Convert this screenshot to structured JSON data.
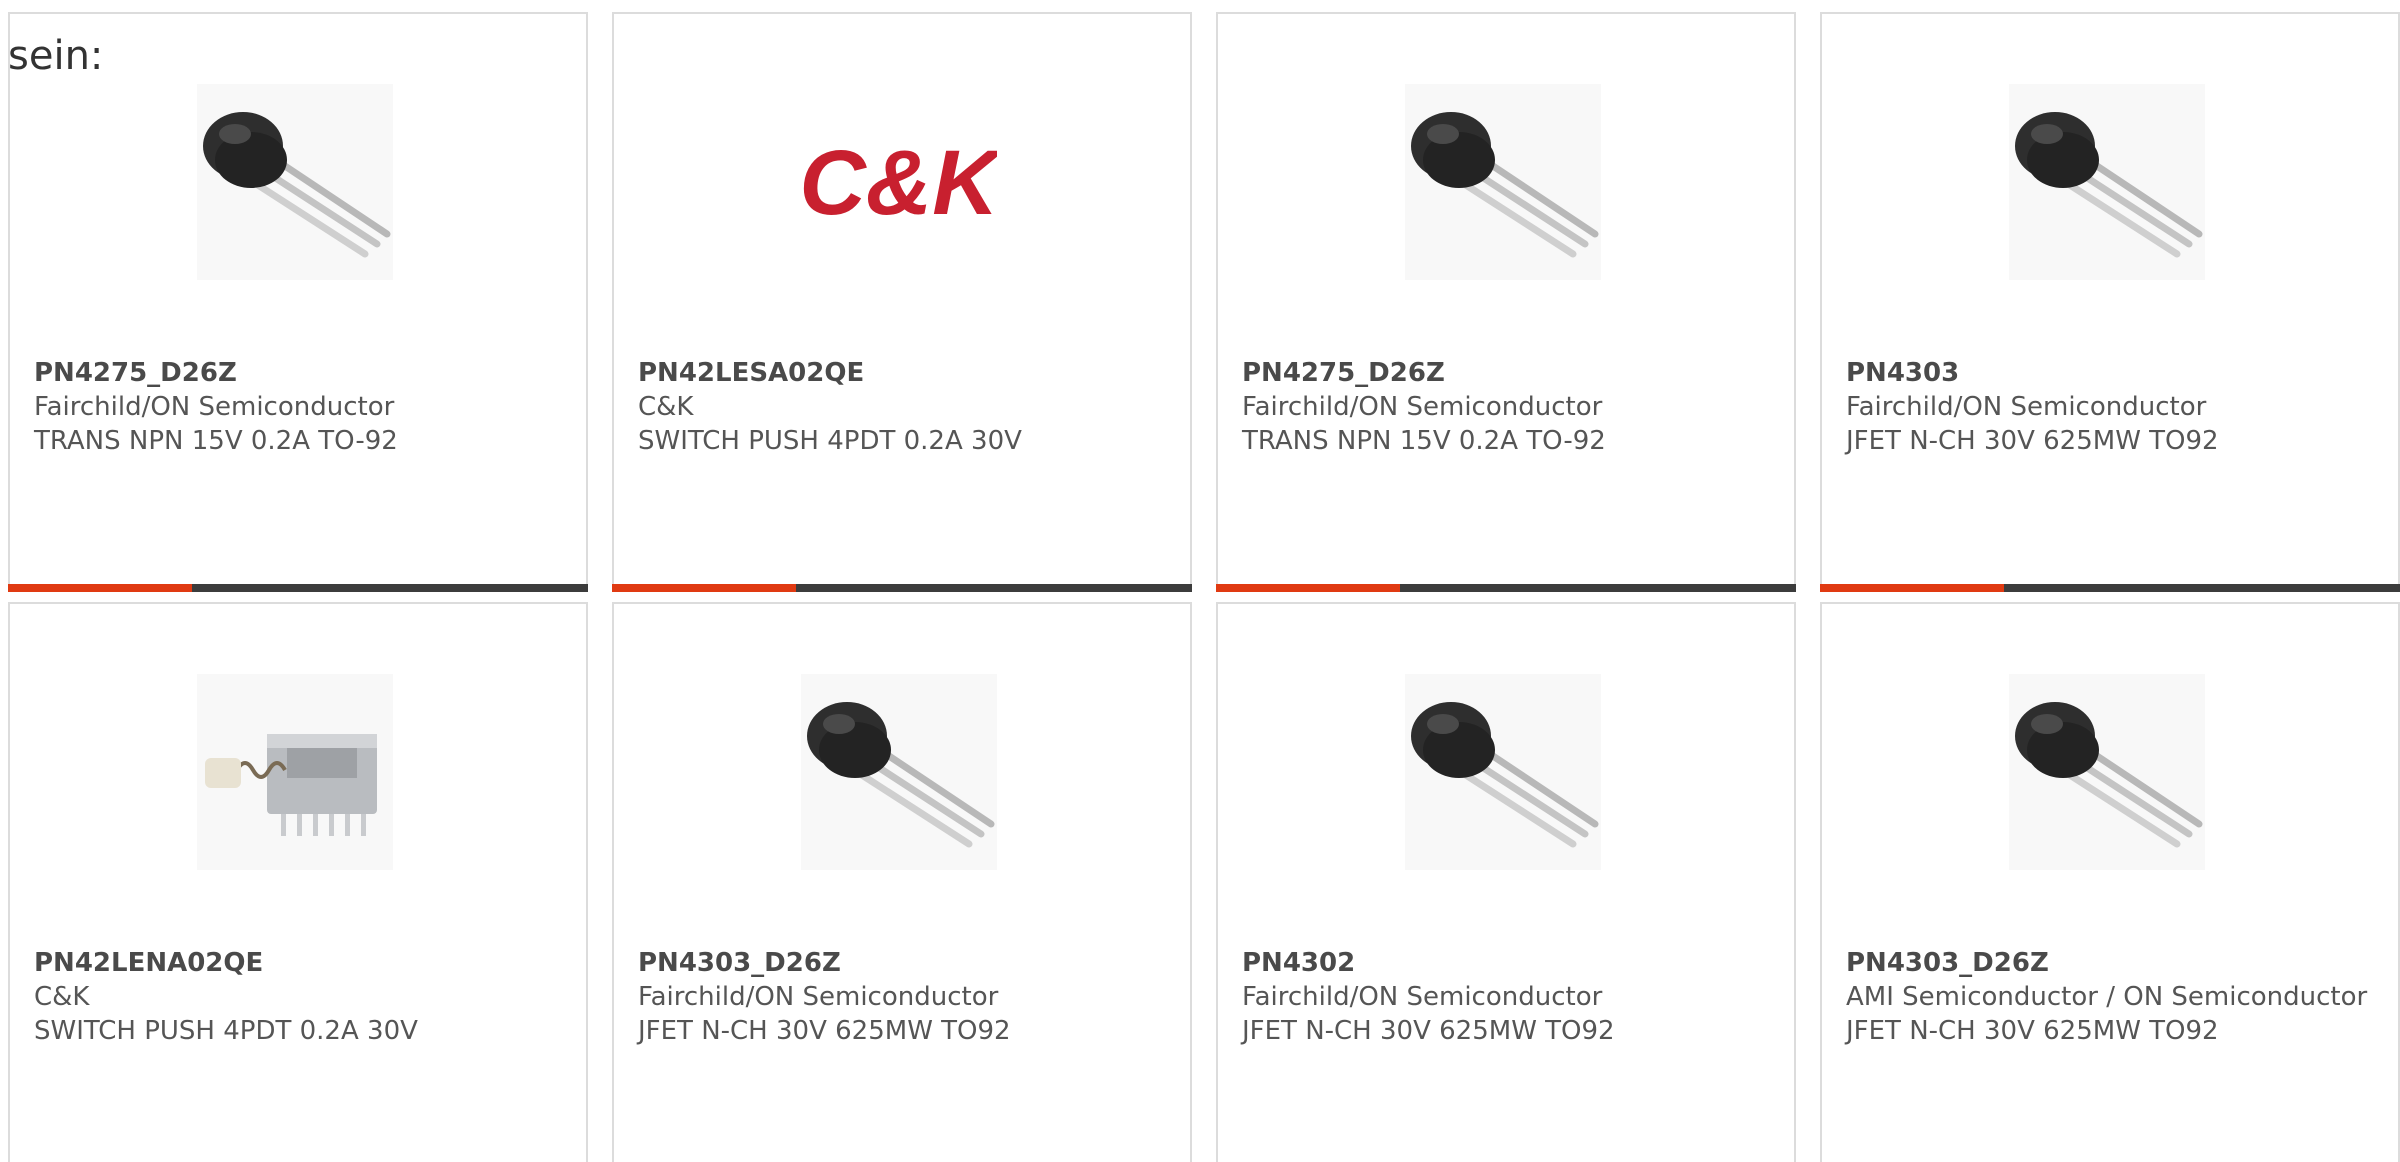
{
  "intro_text": "sein:",
  "colors": {
    "accent": "#e03a12",
    "bar_dark": "#3c3c3c",
    "card_border": "#dcdcdc",
    "text": "#555555",
    "ck_logo_red": "#c8202f"
  },
  "products": [
    {
      "part": "PN4275_D26Z",
      "manufacturer": "Fairchild/ON Semiconductor",
      "description": "TRANS NPN 15V 0.2A TO-92",
      "image": "transistor-to92-icon"
    },
    {
      "part": "PN42LESA02QE",
      "manufacturer": "C&K",
      "description": "SWITCH PUSH 4PDT 0.2A 30V",
      "image": "ck-logo",
      "image_text": "C&K"
    },
    {
      "part": "PN4275_D26Z",
      "manufacturer": "Fairchild/ON Semiconductor",
      "description": "TRANS NPN 15V 0.2A TO-92",
      "image": "transistor-to92-icon"
    },
    {
      "part": "PN4303",
      "manufacturer": "Fairchild/ON Semiconductor",
      "description": "JFET N-CH 30V 625MW TO92",
      "image": "transistor-to92-icon"
    },
    {
      "part": "PN42LENA02QE",
      "manufacturer": "C&K",
      "description": "SWITCH PUSH 4PDT 0.2A 30V",
      "image": "push-switch-icon"
    },
    {
      "part": "PN4303_D26Z",
      "manufacturer": "Fairchild/ON Semiconductor",
      "description": "JFET N-CH 30V 625MW TO92",
      "image": "transistor-to92-icon"
    },
    {
      "part": "PN4302",
      "manufacturer": "Fairchild/ON Semiconductor",
      "description": "JFET N-CH 30V 625MW TO92",
      "image": "transistor-to92-icon"
    },
    {
      "part": "PN4303_D26Z",
      "manufacturer": "AMI Semiconductor / ON Semiconductor",
      "description": "JFET N-CH 30V 625MW TO92",
      "image": "transistor-to92-icon"
    }
  ]
}
